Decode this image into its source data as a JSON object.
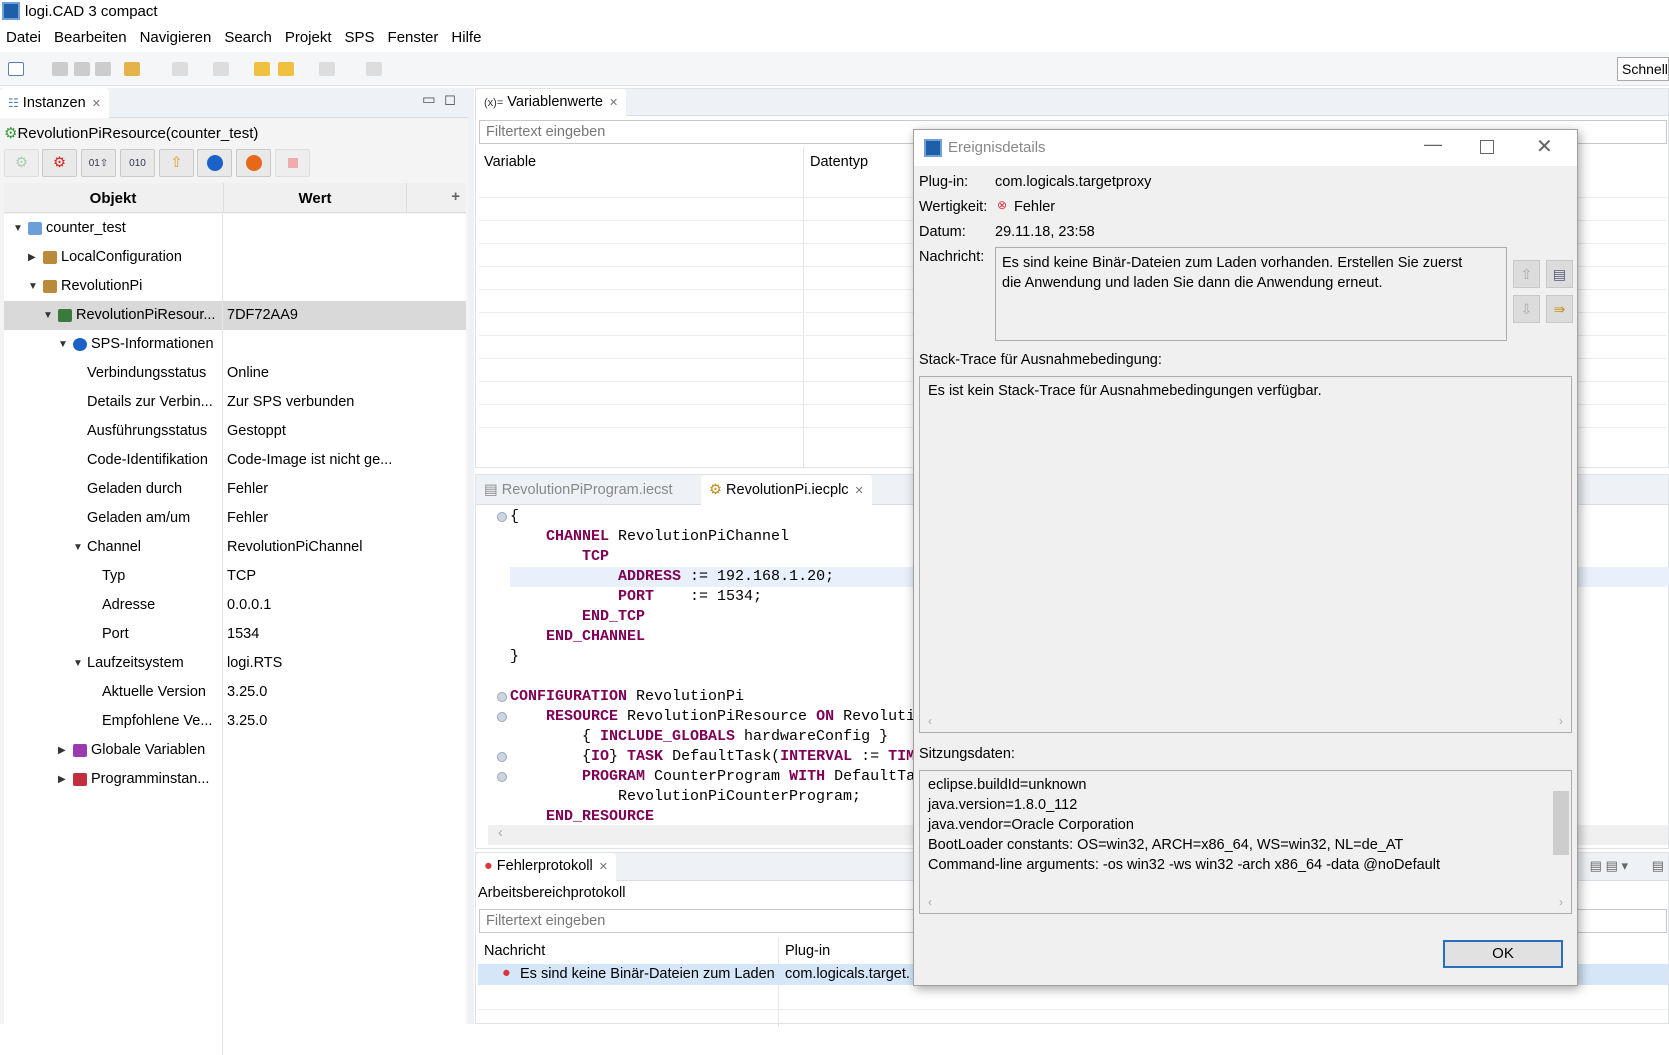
{
  "app": {
    "title": "logi.CAD 3 compact"
  },
  "menu": [
    "Datei",
    "Bearbeiten",
    "Navigieren",
    "Search",
    "Projekt",
    "SPS",
    "Fenster",
    "Hilfe"
  ],
  "quick_access": "Schnell",
  "instances": {
    "tab": "Instanzen",
    "resource": "RevolutionPiResource(counter_test)",
    "columns": [
      "Objekt",
      "Wert"
    ],
    "rows": [
      {
        "level": 0,
        "toggle": "open",
        "icon": "folder",
        "label": "counter_test",
        "value": ""
      },
      {
        "level": 1,
        "toggle": "closed",
        "icon": "config",
        "label": "LocalConfiguration",
        "value": ""
      },
      {
        "level": 1,
        "toggle": "open",
        "icon": "config",
        "label": "RevolutionPi",
        "value": ""
      },
      {
        "level": 2,
        "toggle": "open",
        "icon": "resource",
        "label": "RevolutionPiResour...",
        "value": "7DF72AA9",
        "selected": true
      },
      {
        "level": 3,
        "toggle": "open",
        "icon": "info",
        "label": "SPS-Informationen",
        "value": ""
      },
      {
        "level": 4,
        "label": "Verbindungsstatus",
        "value": "Online"
      },
      {
        "level": 4,
        "label": "Details zur Verbin...",
        "value": "Zur SPS verbunden"
      },
      {
        "level": 4,
        "label": "Ausführungsstatus",
        "value": "Gestoppt"
      },
      {
        "level": 4,
        "label": "Code-Identifikation",
        "value": "Code-Image ist nicht ge..."
      },
      {
        "level": 4,
        "label": "Geladen durch",
        "value": "Fehler"
      },
      {
        "level": 4,
        "label": "Geladen am/um",
        "value": "Fehler"
      },
      {
        "level": 4,
        "toggle": "open",
        "label": "Channel",
        "value": "RevolutionPiChannel"
      },
      {
        "level": 5,
        "label": "Typ",
        "value": "TCP"
      },
      {
        "level": 5,
        "label": "Adresse",
        "value": "0.0.0.1"
      },
      {
        "level": 5,
        "label": "Port",
        "value": "1534"
      },
      {
        "level": 4,
        "toggle": "open",
        "label": "Laufzeitsystem",
        "value": "logi.RTS"
      },
      {
        "level": 5,
        "label": "Aktuelle Version",
        "value": "3.25.0"
      },
      {
        "level": 5,
        "label": "Empfohlene Ve...",
        "value": "3.25.0"
      },
      {
        "level": 3,
        "toggle": "closed",
        "icon": "globals",
        "label": "Globale Variablen",
        "value": ""
      },
      {
        "level": 3,
        "toggle": "closed",
        "icon": "program",
        "label": "Programminstan...",
        "value": ""
      }
    ]
  },
  "variables": {
    "tab": "Variablenwerte",
    "filter_placeholder": "Filtertext eingeben",
    "columns": [
      "Variable",
      "Datentyp"
    ]
  },
  "editor": {
    "tabs": [
      {
        "label": "RevolutionPiProgram.iecst",
        "active": false
      },
      {
        "label": "RevolutionPi.iecplc",
        "active": true
      }
    ],
    "lines": [
      {
        "fold": true,
        "tokens": [
          [
            "{",
            ""
          ]
        ]
      },
      {
        "tokens": [
          [
            "    ",
            ""
          ],
          [
            "CHANNEL",
            "kw"
          ],
          [
            " RevolutionPiChannel",
            ""
          ]
        ]
      },
      {
        "tokens": [
          [
            "        ",
            ""
          ],
          [
            "TCP",
            "kw"
          ]
        ]
      },
      {
        "highlight": true,
        "tokens": [
          [
            "            ",
            ""
          ],
          [
            "ADDRESS",
            "kw"
          ],
          [
            " := 192.168.1.20;",
            ""
          ]
        ]
      },
      {
        "tokens": [
          [
            "            ",
            ""
          ],
          [
            "PORT",
            "kw"
          ],
          [
            "    := 1534;",
            ""
          ]
        ]
      },
      {
        "tokens": [
          [
            "        ",
            ""
          ],
          [
            "END_TCP",
            "kw"
          ]
        ]
      },
      {
        "tokens": [
          [
            "    ",
            ""
          ],
          [
            "END_CHANNEL",
            "kw"
          ]
        ]
      },
      {
        "tokens": [
          [
            "}",
            ""
          ]
        ]
      },
      {
        "tokens": []
      },
      {
        "fold": true,
        "tokens": [
          [
            "CONFIGURATION",
            "kw"
          ],
          [
            " RevolutionPi",
            ""
          ]
        ]
      },
      {
        "fold": true,
        "tokens": [
          [
            "    ",
            ""
          ],
          [
            "RESOURCE",
            "kw"
          ],
          [
            " RevolutionPiResource ",
            ""
          ],
          [
            "ON",
            "kw"
          ],
          [
            " Revoluti",
            ""
          ]
        ]
      },
      {
        "tokens": [
          [
            "        { ",
            ""
          ],
          [
            "INCLUDE_GLOBALS",
            "kw"
          ],
          [
            " hardwareConfig }",
            ""
          ]
        ]
      },
      {
        "fold": true,
        "tokens": [
          [
            "        {",
            ""
          ],
          [
            "IO",
            "kw"
          ],
          [
            "} ",
            ""
          ],
          [
            "TASK",
            "kw"
          ],
          [
            " DefaultTask(",
            ""
          ],
          [
            "INTERVAL",
            "kw"
          ],
          [
            " := ",
            ""
          ],
          [
            "TIM",
            "kw"
          ]
        ]
      },
      {
        "fold": true,
        "tokens": [
          [
            "        ",
            ""
          ],
          [
            "PROGRAM",
            "kw"
          ],
          [
            " CounterProgram ",
            ""
          ],
          [
            "WITH",
            "kw"
          ],
          [
            " DefaultTa",
            ""
          ]
        ]
      },
      {
        "tokens": [
          [
            "            RevolutionPiCounterProgram;",
            ""
          ]
        ]
      },
      {
        "tokens": [
          [
            "    ",
            ""
          ],
          [
            "END_RESOURCE",
            "kw"
          ]
        ]
      }
    ]
  },
  "errorlog": {
    "tab": "Fehlerprotokoll",
    "subtitle": "Arbeitsbereichprotokoll",
    "filter_placeholder": "Filtertext eingeben",
    "columns": [
      "Nachricht",
      "Plug-in"
    ],
    "rows": [
      {
        "message": "Es sind keine Binär-Dateien zum Laden",
        "plugin": "com.logicals.target."
      }
    ]
  },
  "dialog": {
    "title": "Ereignisdetails",
    "plugin_label": "Plug-in:",
    "plugin": "com.logicals.targetproxy",
    "severity_label": "Wertigkeit:",
    "severity": "Fehler",
    "date_label": "Datum:",
    "date": "29.11.18, 23:58",
    "message_label": "Nachricht:",
    "message": "Es sind keine Binär-Dateien zum Laden vorhanden. Erstellen Sie zuerst die Anwendung und laden Sie dann die Anwendung erneut.",
    "stack_label": "Stack-Trace für Ausnahmebedingung:",
    "stack": "Es ist kein Stack-Trace für Ausnahmebedingungen verfügbar.",
    "session_label": "Sitzungsdaten:",
    "session": [
      "eclipse.buildId=unknown",
      "java.version=1.8.0_112",
      "java.vendor=Oracle Corporation",
      "BootLoader constants: OS=win32, ARCH=x86_64, WS=win32, NL=de_AT",
      "Command-line arguments:  -os win32 -ws win32 -arch x86_64 -data @noDefault"
    ],
    "ok": "OK"
  },
  "colors": {
    "keyword": "#7f0055",
    "error": "#d9363e",
    "accent": "#2a6fbd",
    "selection": "#d9d9d9",
    "line_highlight": "#e8f0fb"
  }
}
